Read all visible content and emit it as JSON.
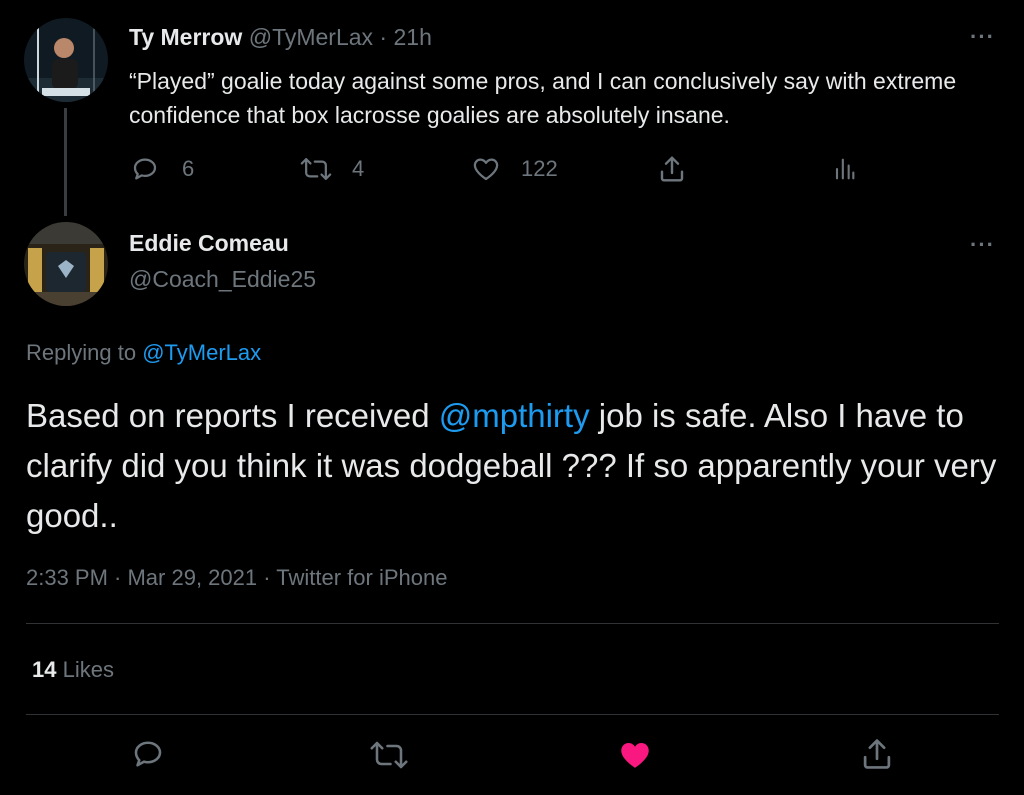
{
  "parent_tweet": {
    "display_name": "Ty Merrow",
    "handle": "@TyMerLax",
    "separator": " · ",
    "time": "21h",
    "text": "“Played” goalie today against some pros, and I can conclusively say with extreme confidence that box lacrosse goalies are absolutely insane.",
    "reply_count": "6",
    "retweet_count": "4",
    "like_count": "122",
    "more": "···"
  },
  "main_tweet": {
    "display_name": "Eddie Comeau",
    "handle": "@Coach_Eddie25",
    "more": "···",
    "replying_to_label": "Replying to",
    "replying_to_handle": "@TyMerLax",
    "text_before": "Based on reports I received ",
    "mention": "@mpthirty",
    "text_after": " job is safe. Also I have to clarify did you think it was dodgeball ??? If so apparently your very good..",
    "timestamp": "2:33 PM · Mar 29, 2021 · Twitter for iPhone",
    "likes_count": "14",
    "likes_label": "Likes"
  },
  "colors": {
    "background": "#000000",
    "text": "#e7e9ea",
    "muted": "#6e767d",
    "link": "#1d9bf0",
    "liked": "#f91880"
  },
  "icons": [
    "reply-icon",
    "retweet-icon",
    "like-icon",
    "share-icon",
    "analytics-icon",
    "more-icon"
  ]
}
